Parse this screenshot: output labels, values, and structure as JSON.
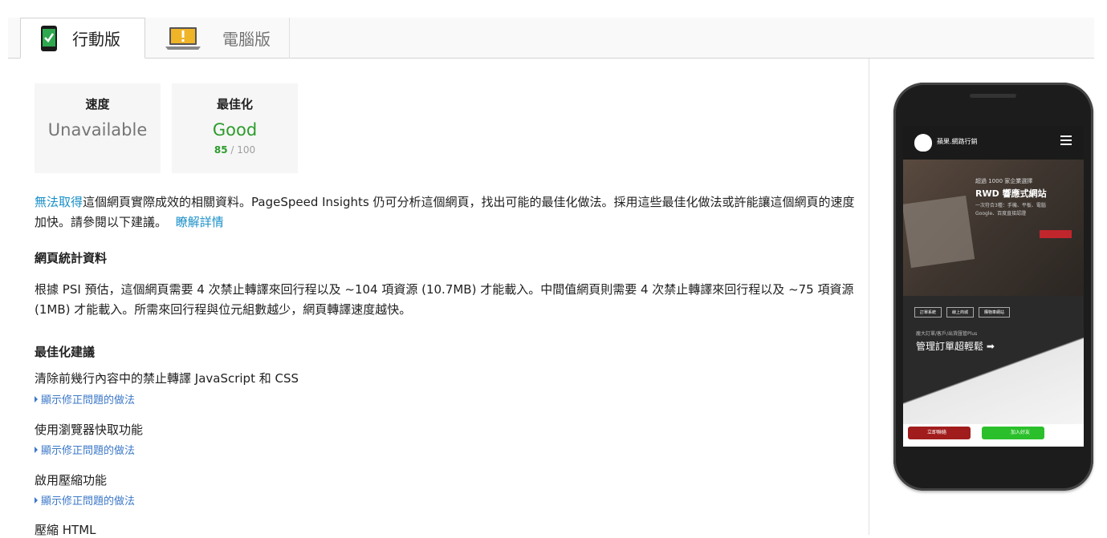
{
  "tabs": [
    {
      "label": "行動版",
      "icon": "mobile-phone-check-icon",
      "active": true
    },
    {
      "label": "電腦版",
      "icon": "laptop-warning-icon",
      "active": false
    }
  ],
  "cards": {
    "speed": {
      "title": "速度",
      "value": "Unavailable"
    },
    "optimization": {
      "title": "最佳化",
      "value": "Good",
      "score": "85",
      "score_total": " / 100"
    }
  },
  "colors": {
    "good": "#2c9c2c",
    "unavailable": "#757575",
    "link": "#1a73e8"
  },
  "intro": {
    "link_unavailable": "無法取得",
    "text": "這個網頁實際成效的相關資料。PageSpeed Insights 仍可分析這個網頁，找出可能的最佳化做法。採用這些最佳化做法或許能讓這個網頁的速度加快。請參閱以下建議。",
    "learn_more": "瞭解詳情"
  },
  "stats": {
    "heading": "網頁統計資料",
    "text": "根據 PSI 預估，這個網頁需要 4 次禁止轉譯來回行程以及 ~104 項資源 (10.7MB) 才能載入。中間值網頁則需要 4 次禁止轉譯來回行程以及 ~75 項資源 (1MB) 才能載入。所需來回行程與位元組數越少，網頁轉譯速度越快。"
  },
  "suggestions": {
    "heading": "最佳化建議",
    "show_fix_label": "顯示修正問題的做法",
    "items": [
      "清除前幾行內容中的禁止轉譯 JavaScript 和 CSS",
      "使用瀏覽器快取功能",
      "啟用壓縮功能",
      "壓縮 HTML"
    ]
  },
  "phone_preview": {
    "brand": "蘋果.網路行銷",
    "hero_line1": "超過 1000 家企業選擇",
    "hero_line2": "RWD 響應式網站",
    "hero_line3": "一次符合3種：手機、平板、電腦",
    "hero_line4": "Google、百度直接認證",
    "tabs": [
      "訂單系統",
      "線上商城",
      "購物車網站"
    ],
    "sub_small": "龐大訂單/客戶/出貨匯管Plus",
    "sub_big": "管理訂單超輕鬆 ➡",
    "call_label": "立即聯絡",
    "line_label": "加入好友"
  }
}
